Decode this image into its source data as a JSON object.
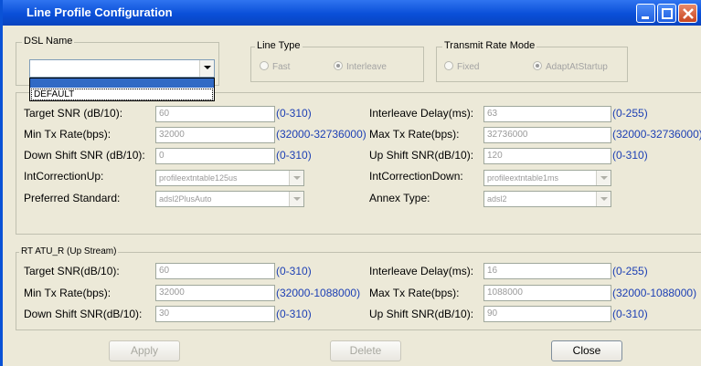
{
  "window": {
    "title": "Line Profile Configuration"
  },
  "dsl_name": {
    "group_label": "DSL Name",
    "value": "",
    "dropdown_options": [
      "DEFAULT"
    ]
  },
  "line_type": {
    "group_label": "Line Type",
    "options": [
      "Fast",
      "Interleave"
    ],
    "selected": "Interleave"
  },
  "transmit_rate_mode": {
    "group_label": "Transmit Rate Mode",
    "options": [
      "Fixed",
      "AdaptAtStartup"
    ],
    "selected": "AdaptAtStartup"
  },
  "downstream": {
    "target_snr": {
      "label": "Target SNR (dB/10):",
      "value": "60",
      "range": "(0-310)"
    },
    "interleave_delay": {
      "label": "Interleave Delay(ms):",
      "value": "63",
      "range": "(0-255)"
    },
    "min_tx_rate": {
      "label": "Min Tx Rate(bps):",
      "value": "32000",
      "range": "(32000-32736000)"
    },
    "max_tx_rate": {
      "label": "Max Tx Rate(bps):",
      "value": "32736000",
      "range": "(32000-32736000)"
    },
    "down_shift_snr": {
      "label": "Down Shift SNR (dB/10):",
      "value": "0",
      "range": "(0-310)"
    },
    "up_shift_snr": {
      "label": "Up Shift SNR(dB/10):",
      "value": "120",
      "range": "(0-310)"
    },
    "int_correction_up": {
      "label": "IntCorrectionUp:",
      "value": "profileextntable125us"
    },
    "int_correction_down": {
      "label": "IntCorrectionDown:",
      "value": "profileextntable1ms"
    },
    "preferred_standard": {
      "label": "Preferred Standard:",
      "value": "adsl2PlusAuto"
    },
    "annex_type": {
      "label": "Annex Type:",
      "value": "adsl2"
    }
  },
  "upstream": {
    "group_label": "RT ATU_R (Up Stream)",
    "target_snr": {
      "label": "Target SNR(dB/10):",
      "value": "60",
      "range": "(0-310)"
    },
    "interleave_delay": {
      "label": "Interleave Delay(ms):",
      "value": "16",
      "range": "(0-255)"
    },
    "min_tx_rate": {
      "label": "Min Tx Rate(bps):",
      "value": "32000",
      "range": "(32000-1088000)"
    },
    "max_tx_rate": {
      "label": "Max Tx Rate(bps):",
      "value": "1088000",
      "range": "(32000-1088000)"
    },
    "down_shift_snr": {
      "label": "Down Shift SNR(dB/10):",
      "value": "30",
      "range": "(0-310)"
    },
    "up_shift_snr": {
      "label": "Up Shift SNR(dB/10):",
      "value": "90",
      "range": "(0-310)"
    }
  },
  "buttons": {
    "apply": "Apply",
    "delete": "Delete",
    "close": "Close"
  },
  "colors": {
    "titlebar": "#0a52d6",
    "dialog_bg": "#ece9d8",
    "range_text": "#1c3fb4",
    "selection": "#316ac5"
  },
  "icons": [
    "minimize-icon",
    "maximize-icon",
    "close-icon",
    "chevron-down-icon"
  ]
}
